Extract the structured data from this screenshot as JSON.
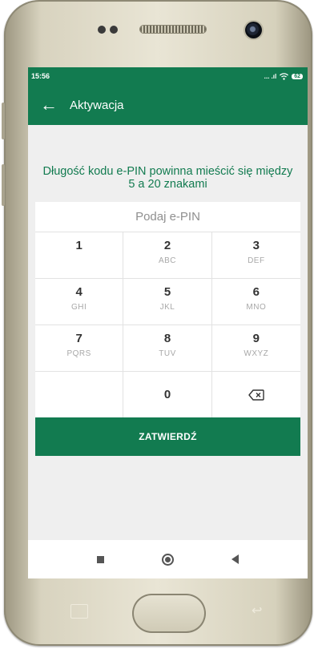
{
  "status_bar": {
    "time": "15:56",
    "signal_text": "... .ıl",
    "wifi": "wifi-icon",
    "battery": "62"
  },
  "app_bar": {
    "back_icon": "arrow-left-icon",
    "title": "Aktywacja"
  },
  "message": "Długość kodu e-PIN powinna mieścić się między 5 a 20 znakami",
  "pin_input": {
    "placeholder": "Podaj e-PIN",
    "value": ""
  },
  "keypad": [
    {
      "digit": "1",
      "letters": ""
    },
    {
      "digit": "2",
      "letters": "ABC"
    },
    {
      "digit": "3",
      "letters": "DEF"
    },
    {
      "digit": "4",
      "letters": "GHI"
    },
    {
      "digit": "5",
      "letters": "JKL"
    },
    {
      "digit": "6",
      "letters": "MNO"
    },
    {
      "digit": "7",
      "letters": "PQRS"
    },
    {
      "digit": "8",
      "letters": "TUV"
    },
    {
      "digit": "9",
      "letters": "WXYZ"
    },
    {
      "digit": "0",
      "letters": ""
    }
  ],
  "backspace_icon": "backspace-icon",
  "confirm_button": "ZATWIERDŹ",
  "nav": {
    "recents": "square-icon",
    "home": "circle-icon",
    "back": "triangle-back-icon"
  },
  "colors": {
    "brand_green": "#127b50",
    "background": "#efefef",
    "placeholder": "#8f8f8f"
  }
}
